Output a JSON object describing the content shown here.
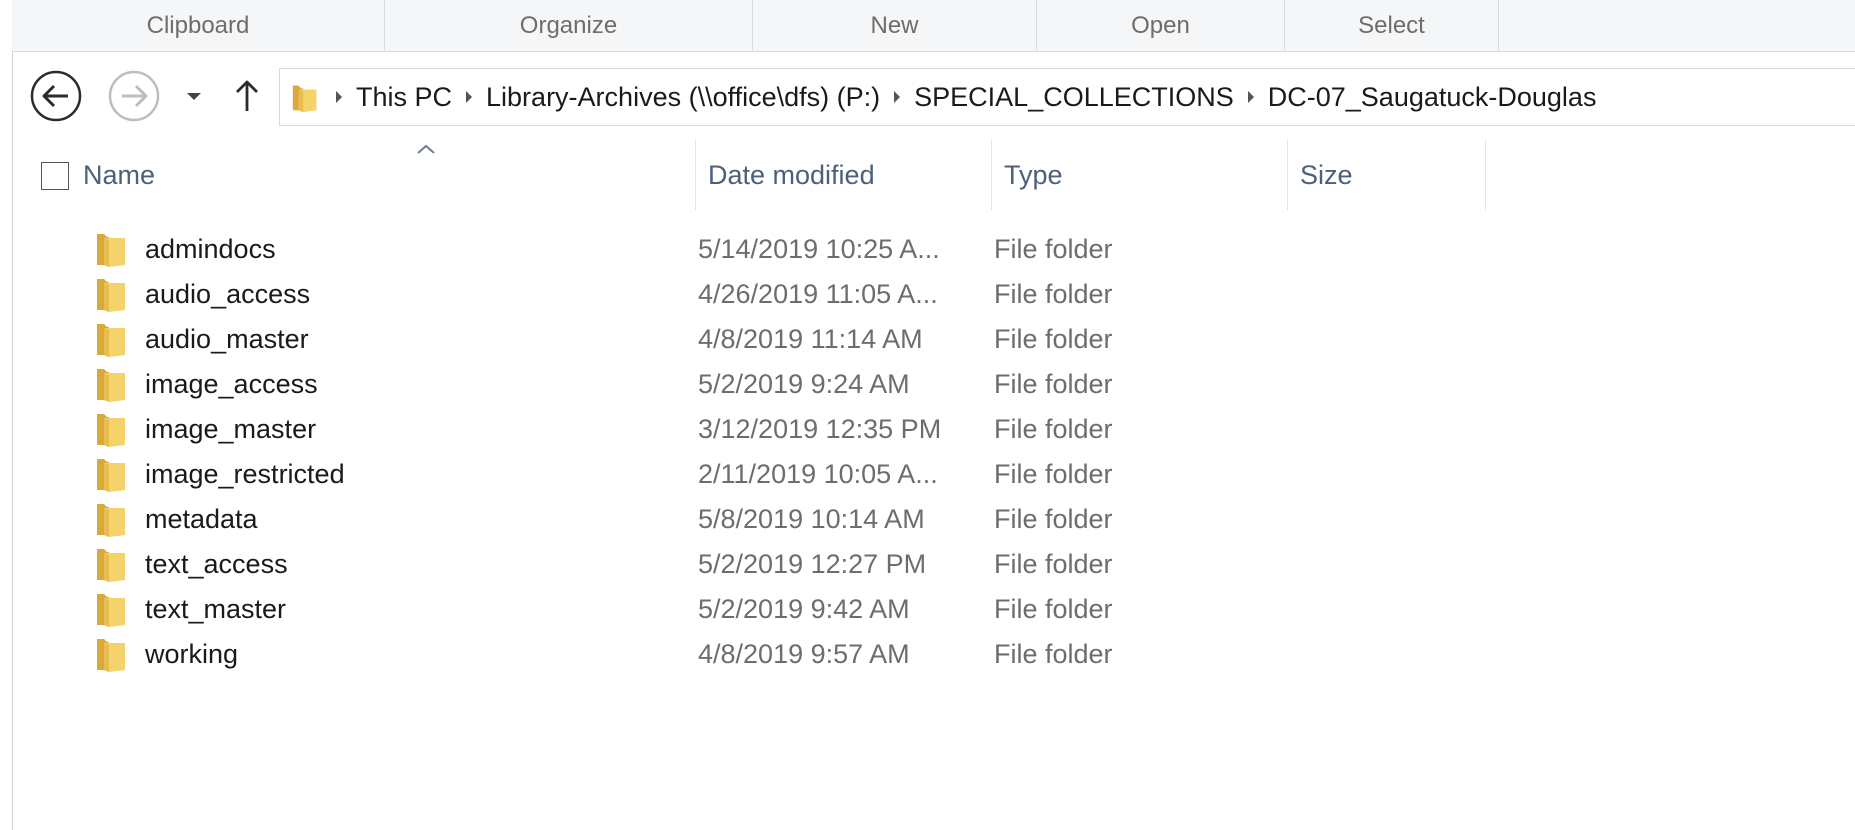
{
  "ribbon": {
    "groups": [
      "Clipboard",
      "Organize",
      "New",
      "Open",
      "Select"
    ]
  },
  "navigation": {
    "back_icon": "back-arrow-icon",
    "forward_icon": "forward-arrow-icon",
    "recent_icon": "chevron-down-icon",
    "up_icon": "up-arrow-icon"
  },
  "address": {
    "folder_icon": "folder-icon",
    "breadcrumbs": [
      "This PC",
      "Library-Archives (\\\\office\\dfs) (P:)",
      "SPECIAL_COLLECTIONS",
      "DC-07_Saugatuck-Douglas"
    ]
  },
  "columns": {
    "name": "Name",
    "date": "Date modified",
    "type": "Type",
    "size": "Size"
  },
  "files": [
    {
      "name": "admindocs",
      "date": "5/14/2019 10:25 A...",
      "type": "File folder"
    },
    {
      "name": "audio_access",
      "date": "4/26/2019 11:05 A...",
      "type": "File folder"
    },
    {
      "name": "audio_master",
      "date": "4/8/2019 11:14 AM",
      "type": "File folder"
    },
    {
      "name": "image_access",
      "date": "5/2/2019 9:24 AM",
      "type": "File folder"
    },
    {
      "name": "image_master",
      "date": "3/12/2019 12:35 PM",
      "type": "File folder"
    },
    {
      "name": "image_restricted",
      "date": "2/11/2019 10:05 A...",
      "type": "File folder"
    },
    {
      "name": "metadata",
      "date": "5/8/2019 10:14 AM",
      "type": "File folder"
    },
    {
      "name": "text_access",
      "date": "5/2/2019 12:27 PM",
      "type": "File folder"
    },
    {
      "name": "text_master",
      "date": "5/2/2019 9:42 AM",
      "type": "File folder"
    },
    {
      "name": "working",
      "date": "4/8/2019 9:57 AM",
      "type": "File folder"
    }
  ],
  "colors": {
    "header_text": "#4c607a",
    "secondary_text": "#6d6d6d",
    "folder_yellow": "#f5d36b",
    "folder_dark": "#d9a93a"
  }
}
